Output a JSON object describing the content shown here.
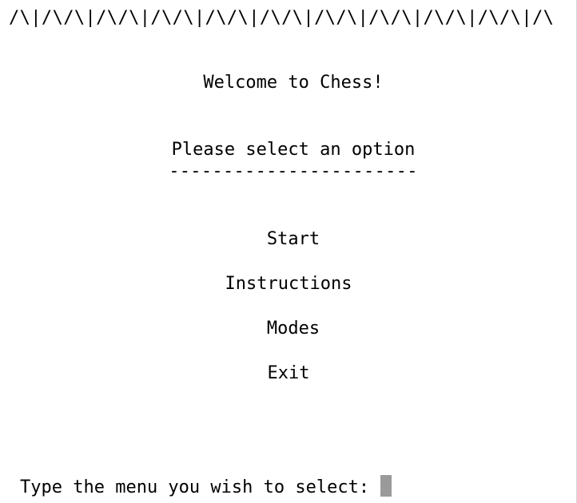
{
  "border": "/\\|/\\/\\|/\\/\\|/\\/\\|/\\/\\|/\\/\\|/\\/\\|/\\/\\|/\\/\\|/\\/\\|/\\",
  "header": {
    "welcome": "Welcome to Chess!",
    "instruction": "Please select an option",
    "underline": "-----------------------"
  },
  "menu": {
    "items": [
      {
        "label": "Start"
      },
      {
        "label": "Instructions"
      },
      {
        "label": "Modes"
      },
      {
        "label": "Exit"
      }
    ]
  },
  "input": {
    "prompt": "Type the menu you wish to select:"
  },
  "colors": {
    "background": "#ffffff",
    "text": "#000000",
    "cursor": "#9a9a9a"
  }
}
